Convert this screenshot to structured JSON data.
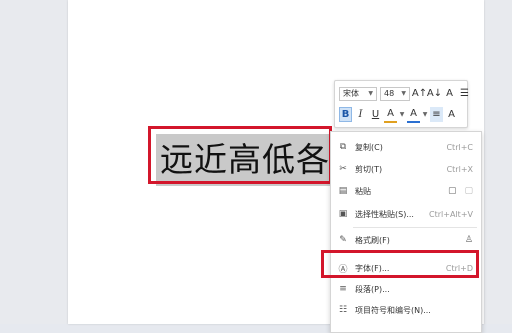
{
  "document": {
    "text": "远近高低各不"
  },
  "mini_toolbar": {
    "font_name": "宋体",
    "font_size": "48",
    "grow_font_icon": "A↑",
    "shrink_font_icon": "A↓",
    "format_icon": "A",
    "list_icon": "☰",
    "bold": "B",
    "italic": "I",
    "underline": "U",
    "font_color": "A",
    "highlight_color": "A",
    "paragraph_align": "≡",
    "clear_format": "A"
  },
  "context_menu": {
    "items": [
      {
        "icon": "⧉",
        "label": "复制(C)",
        "shortcut": "Ctrl+C"
      },
      {
        "icon": "✂",
        "label": "剪切(T)",
        "shortcut": "Ctrl+X"
      },
      {
        "icon": "▤",
        "label": "粘贴",
        "shortcut": ""
      },
      {
        "icon": "▣",
        "label": "选择性粘贴(S)...",
        "shortcut": "Ctrl+Alt+V"
      },
      {
        "icon": "✎",
        "label": "格式刷(F)",
        "shortcut": ""
      },
      {
        "icon": "Ⓐ",
        "label": "字体(F)...",
        "shortcut": "Ctrl+D"
      },
      {
        "icon": "≡",
        "label": "段落(P)...",
        "shortcut": ""
      },
      {
        "icon": "☷",
        "label": "项目符号和编号(N)...",
        "shortcut": ""
      }
    ]
  },
  "colors": {
    "highlight_red": "#d3162b",
    "selection_gray": "#c9c9c9",
    "accent_blue": "#2a6fd1"
  }
}
